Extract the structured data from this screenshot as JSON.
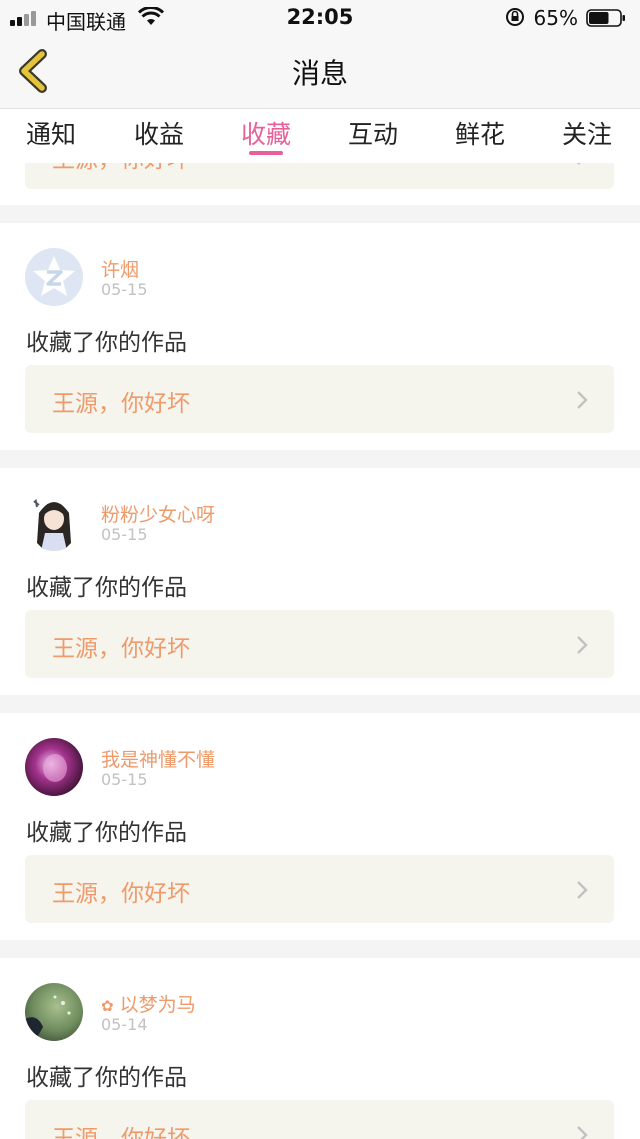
{
  "status_bar": {
    "carrier": "中国联通",
    "time": "22:05",
    "battery_percent": "65%",
    "battery_level": 0.65
  },
  "header": {
    "title": "消息"
  },
  "tabs": [
    {
      "label": "通知"
    },
    {
      "label": "收益"
    },
    {
      "label": "收藏",
      "active": true
    },
    {
      "label": "互动"
    },
    {
      "label": "鲜花"
    },
    {
      "label": "关注"
    }
  ],
  "messages": [
    {
      "name": "",
      "date": "",
      "action": "",
      "work_title": "王源，你好坏"
    },
    {
      "name": "许烟",
      "date": "05-15",
      "action": "收藏了你的作品",
      "work_title": "王源，你好坏",
      "avatar": "qzone-default-icon"
    },
    {
      "name": "粉粉少女心呀",
      "date": "05-15",
      "action": "收藏了你的作品",
      "work_title": "王源，你好坏",
      "avatar": "anime-girl-avatar"
    },
    {
      "name": "我是神懂不懂",
      "date": "05-15",
      "action": "收藏了你的作品",
      "work_title": "王源，你好坏",
      "avatar": "purple-photo-avatar"
    },
    {
      "name": "以梦为马",
      "name_prefix": "✿",
      "date": "05-14",
      "action": "收藏了你的作品",
      "work_title": "王源，你好坏",
      "avatar": "green-photo-avatar"
    }
  ],
  "colors": {
    "accent": "#e8609a",
    "username": "#ef9a6a",
    "back_icon": "#e6c43a"
  }
}
